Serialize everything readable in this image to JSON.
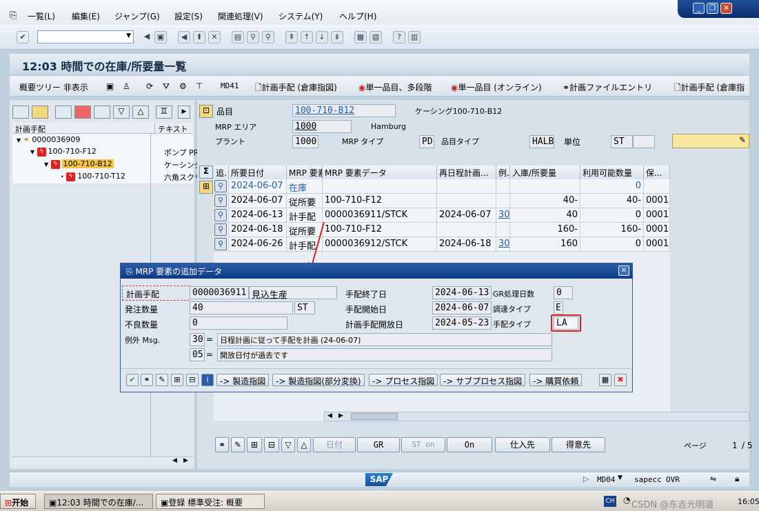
{
  "menu": [
    "一覧(L)",
    "編集(E)",
    "ジャンプ(G)",
    "設定(S)",
    "関連処理(V)",
    "システム(Y)",
    "ヘルプ(H)"
  ],
  "title": "12:03 時間での在庫/所要量一覧",
  "app_toolbar": {
    "overview_tree": "概要ツリー 非表示",
    "md41": "MD41",
    "planned_order": "計画手配 (倉庫指図)",
    "single_multi": "単一品目、多段階",
    "single_online": "単一品目 (オンライン)",
    "plan_file": "計画ファイルエントリ",
    "planned_order2": "計画手配 (倉庫指"
  },
  "tree": {
    "col1": "計画手配",
    "col2": "テキスト",
    "rows": [
      {
        "id": "0000036909",
        "text": ""
      },
      {
        "id": "100-710-F12",
        "text": "ポンプ PRE"
      },
      {
        "id": "100-710-B12",
        "text": "ケーシング"
      },
      {
        "id": "100-710-T12",
        "text": "六角スクリ"
      }
    ]
  },
  "header": {
    "material_label": "品目",
    "material": "100-710-B12",
    "material_desc": "ケーシング100-710-B12",
    "mrp_area_label": "MRP エリア",
    "mrp_area": "1000",
    "mrp_area_desc": "Hamburg",
    "plant_label": "プラント",
    "plant": "1000",
    "mrp_type_label": "MRP タイプ",
    "mrp_type": "PD",
    "material_type_label": "品目タイプ",
    "material_type": "HALB",
    "unit_label": "単位",
    "unit": "ST"
  },
  "grid": {
    "headers": [
      "追.",
      "所要日付",
      "MRP 要素",
      "MRP 要素データ",
      "再日程計画...",
      "例.",
      "入庫/所要量",
      "利用可能数量",
      "保..."
    ],
    "rows": [
      {
        "date": "2024-06-07",
        "elem": "在庫",
        "data": "",
        "resched": "",
        "exc": "",
        "qty": "",
        "avail": "0",
        "stor": ""
      },
      {
        "date": "2024-06-07",
        "elem": "従所要",
        "data": "100-710-F12",
        "resched": "",
        "exc": "",
        "qty": "40-",
        "avail": "40-",
        "stor": "0001"
      },
      {
        "date": "2024-06-13",
        "elem": "計手配",
        "data": "0000036911/STCK",
        "resched": "2024-06-07",
        "exc": "30",
        "qty": "40",
        "avail": "0",
        "stor": "0001"
      },
      {
        "date": "2024-06-18",
        "elem": "従所要",
        "data": "100-710-F12",
        "resched": "",
        "exc": "",
        "qty": "160-",
        "avail": "160-",
        "stor": "0001"
      },
      {
        "date": "2024-06-26",
        "elem": "計手配",
        "data": "0000036912/STCK",
        "resched": "2024-06-18",
        "exc": "30",
        "qty": "160",
        "avail": "0",
        "stor": "0001"
      }
    ]
  },
  "popup": {
    "title": "MRP 要素の追加データ",
    "planned_order_label": "計画手配",
    "planned_order": "0000036911",
    "planned_order_type": "見込生産",
    "order_qty_label": "発注数量",
    "order_qty": "40",
    "order_unit": "ST",
    "scrap_label": "不良数量",
    "scrap": "0",
    "exception_label": "例外 Msg.",
    "exc1_code": "30",
    "exc1_eq": "=",
    "exc1_text": "日程計画に従って手配を計画 (24-06-07)",
    "exc2_code": "05",
    "exc2_eq": "=",
    "exc2_text": "開放日付が過去です",
    "finish_label": "手配終了日",
    "finish": "2024-06-13",
    "start_label": "手配開始日",
    "start": "2024-06-07",
    "open_label": "計画手配開放日",
    "open": "2024-05-23",
    "gr_label": "GR処理日数",
    "gr": "0",
    "proc_label": "調達タイプ",
    "proc": "E",
    "special_label": "手配タイプ",
    "special": "LA",
    "buttons": [
      "-> 製造指図",
      "-> 製造指図(部分変換)",
      "-> プロセス指図",
      "-> サブプロセス指図",
      "-> 購買依頼"
    ]
  },
  "bottom": {
    "date_btn": "日付",
    "gr_btn": "GR",
    "st_on_btn": "ST on",
    "on_btn": "On",
    "vendor_btn": "仕入先",
    "customer_btn": "得意先",
    "page_label": "ページ",
    "page": "1",
    "page_total": "/ 5"
  },
  "status": {
    "tcode": "MD04",
    "server": "sapecc",
    "mode": "OVR",
    "sap": "SAP"
  },
  "taskbar": {
    "start": "开始",
    "task1": "12:03 時間での在庫/...",
    "task2": "登録 標準受注: 概要",
    "lang": "CH",
    "time": "16:05",
    "watermark": "CSDN @东吉光明道"
  }
}
